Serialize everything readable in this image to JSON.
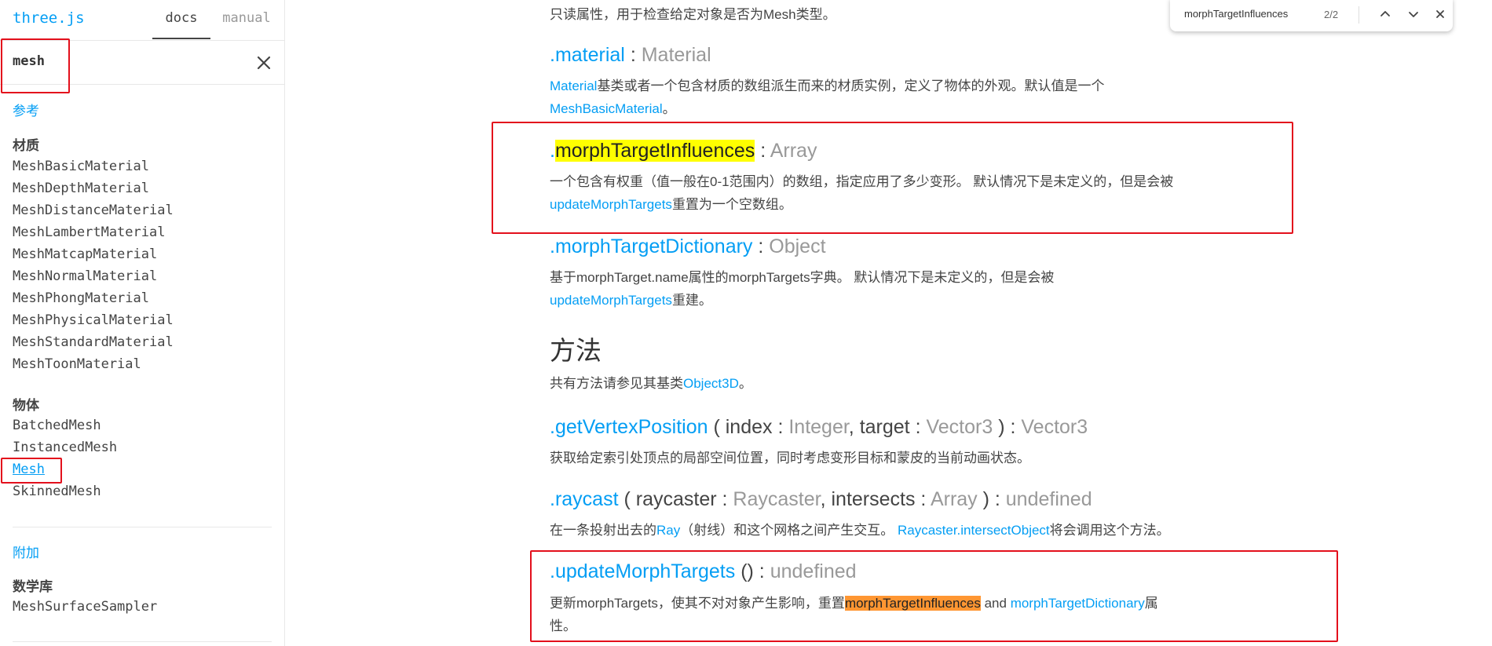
{
  "sidebar": {
    "brand": "three.js",
    "tabs": [
      "docs",
      "manual"
    ],
    "search_value": "mesh",
    "section_reference": "参考",
    "groups": [
      {
        "title": "材质",
        "items": [
          "MeshBasicMaterial",
          "MeshDepthMaterial",
          "MeshDistanceMaterial",
          "MeshLambertMaterial",
          "MeshMatcapMaterial",
          "MeshNormalMaterial",
          "MeshPhongMaterial",
          "MeshPhysicalMaterial",
          "MeshStandardMaterial",
          "MeshToonMaterial"
        ]
      },
      {
        "title": "物体",
        "items": [
          "BatchedMesh",
          "InstancedMesh",
          "Mesh",
          "SkinnedMesh"
        ]
      }
    ],
    "section_addons": "附加",
    "addon_group": {
      "title": "数学库",
      "items": [
        "MeshSurfaceSampler"
      ]
    }
  },
  "content": {
    "intro_text": "只读属性，用于检查给定对象是否为Mesh类型。",
    "material": {
      "name": ".material",
      "sep": " : ",
      "type": "Material",
      "desc_link1": "Material",
      "desc_mid": "基类或者一个包含材质的数组派生而来的材质实例，定义了物体的外观。默认值是一个",
      "desc_link2": "MeshBasicMaterial",
      "desc_end": "。"
    },
    "morphTargetInfluences": {
      "dot": ".",
      "name": "morphTargetInfluences",
      "sep": " : ",
      "type": "Array",
      "desc": "一个包含有权重（值一般在0-1范围内）的数组，指定应用了多少变形。 默认情况下是未定义的，但是会被",
      "desc_link": "updateMorphTargets",
      "desc_end": "重置为一个空数组。"
    },
    "morphTargetDictionary": {
      "name": ".morphTargetDictionary",
      "sep": " : ",
      "type": "Object",
      "desc": "基于morphTarget.name属性的morphTargets字典。 默认情况下是未定义的，但是会被",
      "desc_link": "updateMorphTargets",
      "desc_end": "重建。"
    },
    "methods_heading": "方法",
    "methods_desc": "共有方法请参见其基类",
    "methods_desc_link": "Object3D",
    "methods_desc_end": "。",
    "getVertexPosition": {
      "name": ".getVertexPosition",
      "open": " ( ",
      "p1": "index",
      "p1_type": "Integer",
      "comma": ", ",
      "p2": "target",
      "p2_type": "Vector3",
      "close": " ) : ",
      "ret": "Vector3",
      "desc": "获取给定索引处顶点的局部空间位置，同时考虑变形目标和蒙皮的当前动画状态。"
    },
    "raycast": {
      "name": ".raycast",
      "open": " ( ",
      "p1": "raycaster",
      "p1_type": "Raycaster",
      "comma": ", ",
      "p2": "intersects",
      "p2_type": "Array",
      "close": " ) : ",
      "ret": "undefined",
      "desc": "在一条投射出去的",
      "desc_link1": "Ray",
      "desc_mid": "（射线）和这个网格之间产生交互。 ",
      "desc_link2": "Raycaster.intersectObject",
      "desc_end": "将会调用这个方法。"
    },
    "updateMorphTargets": {
      "name": ".updateMorphTargets",
      "paren": " () : ",
      "ret": "undefined",
      "desc": "更新morphTargets，使其不对对象产生影响，重置",
      "desc_hl": "morphTargetInfluences",
      "desc_and": " and ",
      "desc_link": "morphTargetDictionary",
      "desc_end1": "属",
      "desc_end2": "性。"
    }
  },
  "findbar": {
    "query": "morphTargetInfluences",
    "count": "2/2"
  },
  "colors": {
    "link": "#049ef4",
    "annotation": "#e3101c",
    "highlight_current": "#ffff00",
    "highlight_other": "#ff9632"
  }
}
